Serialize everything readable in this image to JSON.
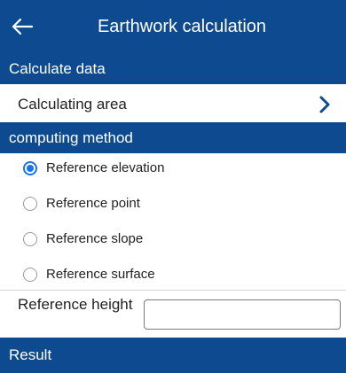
{
  "header": {
    "title": "Earthwork calculation",
    "back_icon": "arrow-left-icon"
  },
  "calculate_data": {
    "section_title": "Calculate data",
    "calculating_area_label": "Calculating area",
    "chevron_icon": "chevron-right-icon"
  },
  "computing_method": {
    "section_title": "computing method",
    "selected": "Reference elevation",
    "options": [
      {
        "label": "Reference elevation",
        "checked": true
      },
      {
        "label": "Reference point",
        "checked": false
      },
      {
        "label": "Reference slope",
        "checked": false
      },
      {
        "label": "Reference surface",
        "checked": false
      }
    ]
  },
  "reference_height": {
    "label": "Reference height",
    "value": "",
    "placeholder": ""
  },
  "result": {
    "section_title": "Result"
  },
  "colors": {
    "header_bg": "#0d4a8f",
    "radio_accent": "#1a73e8",
    "chevron": "#0d4a8f"
  }
}
